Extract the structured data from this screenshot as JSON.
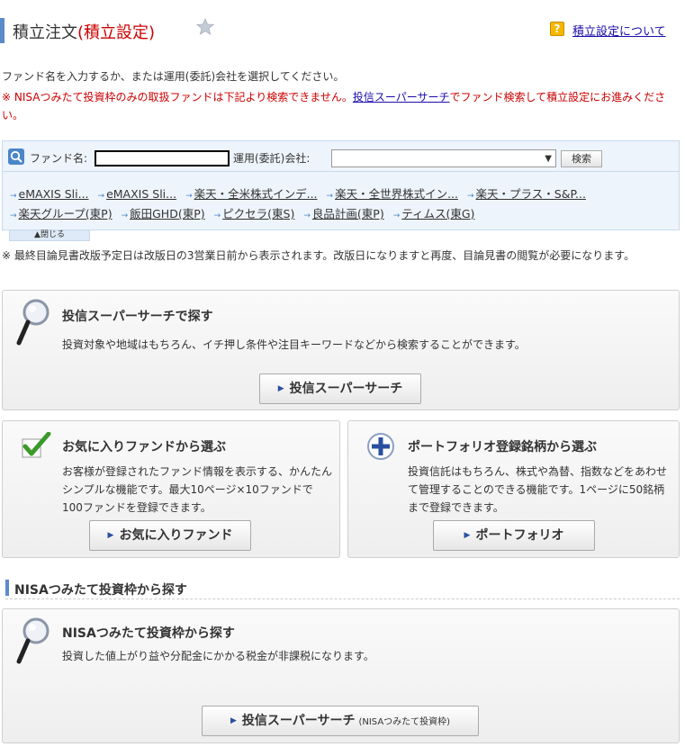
{
  "header": {
    "title": "積立注文",
    "title_suffix": "(積立設定)",
    "help_link": "積立設定について"
  },
  "intro": "ファンド名を入力するか、または運用(委託)会社を選択してください。",
  "notice": {
    "mark": "※",
    "text_before": "NISAつみたて投資枠のみの取扱ファンドは下記より検索できません。",
    "link": "投信スーパーサーチ",
    "text_after": "でファンド検索して積立設定にお進みください。"
  },
  "search": {
    "fund_label": "ファンド名:",
    "fund_value": "",
    "company_label": "運用(委託)会社:",
    "company_selected": "",
    "search_button": "検索",
    "links_row1": [
      "eMAXIS Sli...",
      "eMAXIS Sli...",
      "楽天・全米株式インデ...",
      "楽天・全世界株式イン...",
      "楽天・プラス・S&P..."
    ],
    "links_row2": [
      "楽天グループ(東P)",
      "飯田GHD(東P)",
      "ピクセラ(東S)",
      "良品計画(東P)",
      "ティムス(東G)"
    ],
    "collapse": "閉じる"
  },
  "note2": "※  最終目論見書改版予定日は改版日の3営業日前から表示されます。改版日になりますと再度、目論見書の閲覧が必要になります。",
  "panels": {
    "super_search": {
      "title": "投信スーパーサーチで探す",
      "desc": "投資対象や地域はもちろん、イチ押し条件や注目キーワードなどから検索することができます。",
      "button": "投信スーパーサーチ"
    },
    "favorite": {
      "title": "お気に入りファンドから選ぶ",
      "desc": "お客様が登録されたファンド情報を表示する、かんたんシンプルな機能です。最大10ページ×10ファンドで100ファンドを登録できます。",
      "button": "お気に入りファンド"
    },
    "portfolio": {
      "title": "ポートフォリオ登録銘柄から選ぶ",
      "desc": "投資信託はもちろん、株式や為替、指数などをあわせて管理することのできる機能です。1ページに50銘柄まで登録できます。",
      "button": "ポートフォリオ"
    },
    "nisa": {
      "section": "NISAつみたて投資枠から探す",
      "title": "NISAつみたて投資枠から探す",
      "desc": "投資した値上がり益や分配金にかかる税金が非課税になります。",
      "button": "投信スーパーサーチ",
      "button_sub": "(NISAつみたて投資枠)"
    }
  }
}
